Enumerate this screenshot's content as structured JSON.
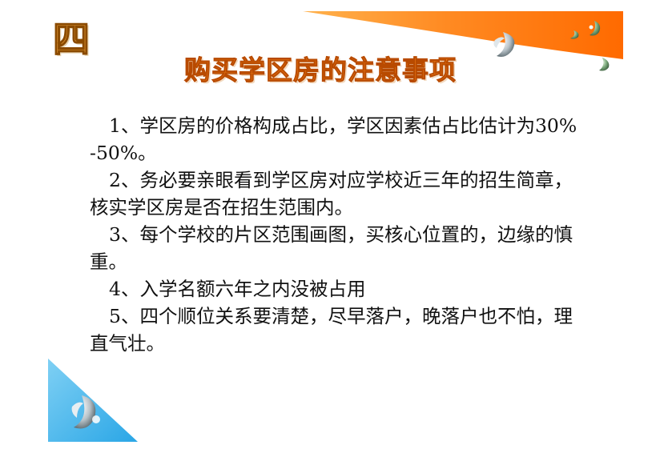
{
  "slide": {
    "chapter_number": "四",
    "title": "购买学区房的注意事项",
    "items": [
      {
        "text": "1、学区房的价格构成占比，学区因素估占比估计为30%-50%。"
      },
      {
        "text": "2、务必要亲眼看到学区房对应学校近三年的招生简章，核实学区房是否在招生范围内。"
      },
      {
        "text": "3、每个学校的片区范围画图，买核心位置的，边缘的慎重。"
      },
      {
        "text": "4、入学名额六年之内没被占用"
      },
      {
        "text": "5、四个顺位关系要清楚，尽早落户，晚落户也不怕，理直气壮。"
      }
    ]
  },
  "colors": {
    "title": "#ff8a1c",
    "chapter_mark": "#ffb14a",
    "top_band": "#ff7f1a",
    "corner_triangle": "#4ab8ec",
    "body_text": "#111111"
  },
  "decorations": {
    "top_right": "orange-band",
    "bottom_left": "blue-triangle",
    "icons": [
      "crescent-leaf-icon"
    ]
  }
}
